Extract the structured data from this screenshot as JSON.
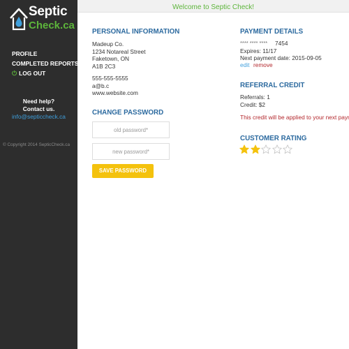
{
  "brand": {
    "name_top": "Septic",
    "name_bottom": "Check.ca",
    "green": "#5db53b",
    "blue_heading": "#2c6a9f",
    "sidebar_bg": "#2d2d2d",
    "button_yellow": "#f4c20d"
  },
  "sidebar": {
    "nav": [
      {
        "label": "PROFILE"
      },
      {
        "label": "COMPLETED REPORTS"
      },
      {
        "label": "LOG OUT",
        "icon": "power-icon"
      }
    ],
    "help_line1": "Need help?",
    "help_line2": "Contact us.",
    "help_email": "info@septiccheck.ca",
    "copyright": "© Copyright 2014 SepticCheck.ca"
  },
  "header": {
    "welcome": "Welcome to Septic Check!"
  },
  "personal": {
    "title": "PERSONAL INFORMATION",
    "company": "Madeup Co.",
    "street": "1234 Notareal Street",
    "city": "Faketown, ON",
    "postal": "A1B 2C3",
    "phone": "555-555-5555",
    "email": "a@b.c",
    "website": "www.website.com"
  },
  "password": {
    "title": "CHANGE PASSWORD",
    "old_placeholder": "old password*",
    "new_placeholder": "new password*",
    "save_label": "SAVE PASSWORD"
  },
  "payment": {
    "title": "PAYMENT DETAILS",
    "card_mask": "**** **** ****",
    "card_last4": "7454",
    "expires": "Expires: 11/17",
    "next_payment": "Next payment date: 2015-09-05",
    "edit_label": "edit",
    "remove_label": "remove"
  },
  "referral": {
    "title": "REFERRAL CREDIT",
    "referrals": "Referrals: 1",
    "credit": "Credit: $2",
    "note": "This credit will be applied to your next payment."
  },
  "rating": {
    "title": "CUSTOMER RATING",
    "value": 2,
    "max": 5,
    "filled_color": "#f4c20d",
    "empty_color": "#c8c8c8"
  }
}
